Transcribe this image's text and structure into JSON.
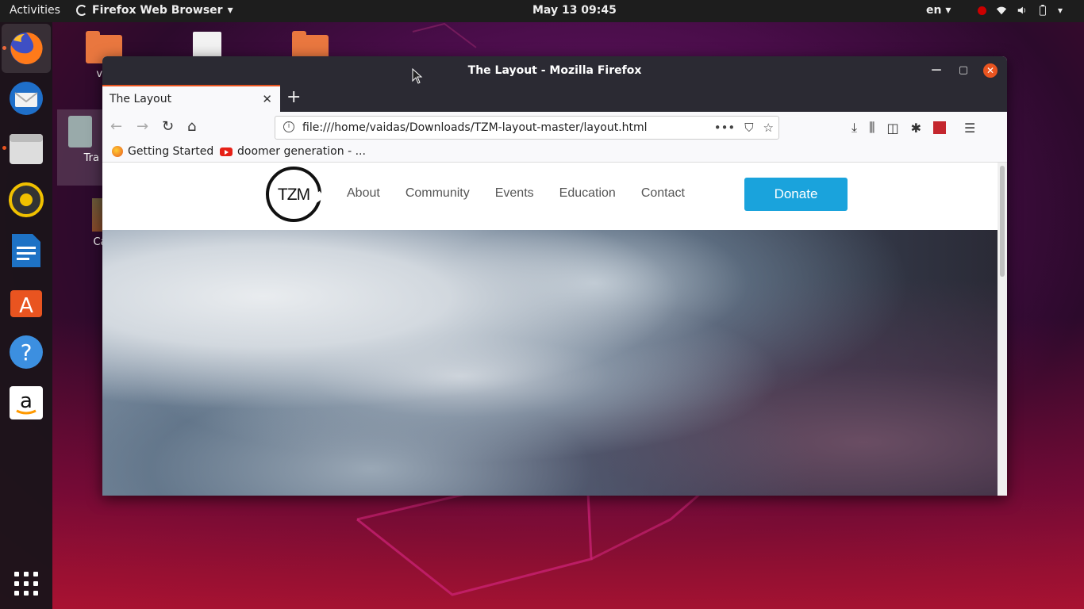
{
  "topbar": {
    "activities": "Activities",
    "app_name": "Firefox Web Browser",
    "clock": "May 13  09:45",
    "language": "en"
  },
  "dock": {
    "items": [
      "firefox",
      "thunderbird",
      "files",
      "rhythmbox",
      "libreoffice-writer",
      "software",
      "help",
      "amazon",
      "show-applications"
    ]
  },
  "desktop": {
    "icons": [
      {
        "label": "vai"
      },
      {
        "label": ""
      },
      {
        "label": ""
      },
      {
        "label": "Tra"
      },
      {
        "label": "Cae"
      }
    ]
  },
  "window": {
    "title": "The Layout - Mozilla Firefox",
    "tab_title": "The Layout",
    "url": "file:///home/vaidas/Downloads/TZM-layout-master/layout.html",
    "bookmarks": [
      {
        "label": "Getting Started"
      },
      {
        "label": "doomer generation - ..."
      }
    ]
  },
  "site": {
    "logo_text": "TZM",
    "nav": [
      "About",
      "Community",
      "Events",
      "Education",
      "Contact"
    ],
    "donate": "Donate"
  },
  "colors": {
    "accent": "#e95420",
    "donate": "#1aa3dc",
    "titlebar": "#2b2a33"
  }
}
